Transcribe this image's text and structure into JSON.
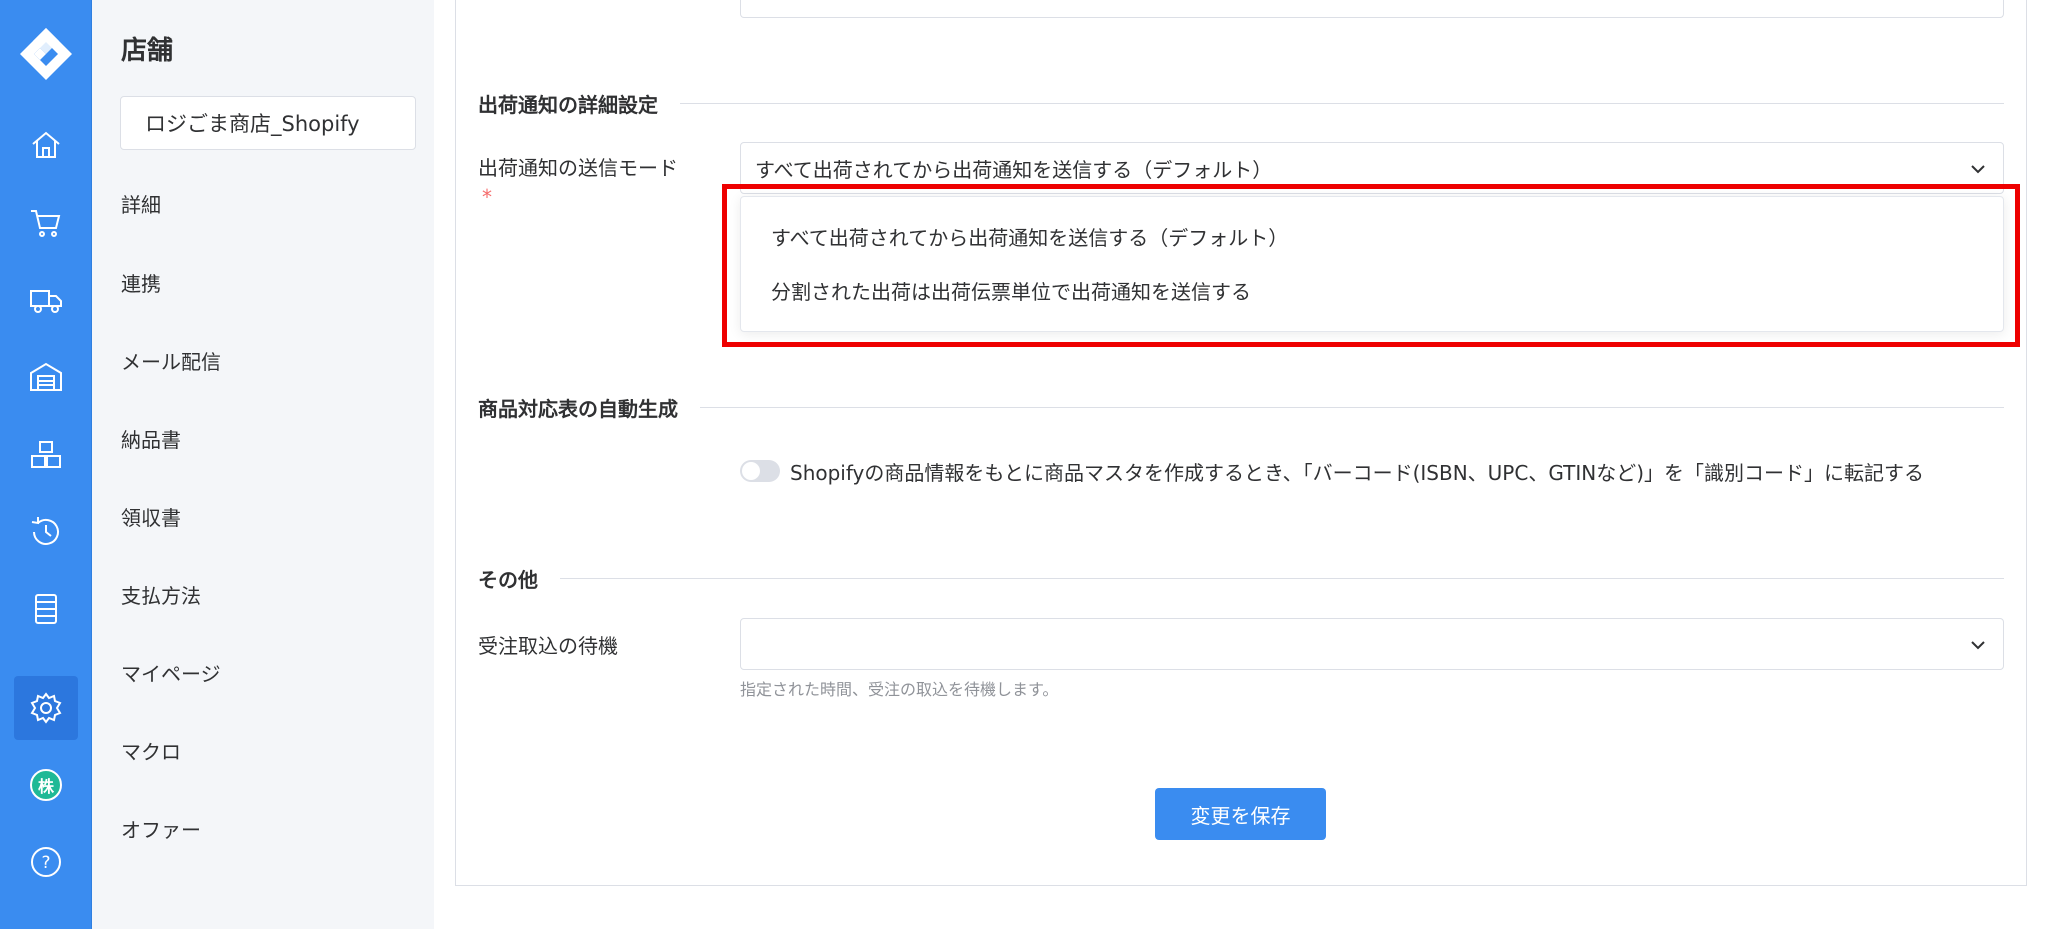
{
  "sidebar": {
    "title": "店舗",
    "store_name": "ロジごま商店_Shopify",
    "items": [
      "詳細",
      "連携",
      "メール配信",
      "納品書",
      "領収書",
      "支払方法",
      "マイページ",
      "マクロ",
      "オファー"
    ]
  },
  "rail": {
    "icons": [
      "home-icon",
      "cart-icon",
      "truck-icon",
      "warehouse-icon",
      "boxes-icon",
      "history-icon",
      "database-icon",
      "gear-icon",
      "company-badge-icon",
      "help-icon"
    ],
    "badge_text": "株",
    "help_text": "?",
    "accent": "#3a8cf0"
  },
  "shipping_notice": {
    "section_title": "出荷通知の詳細設定",
    "mode_label": "出荷通知の送信モード",
    "required_mark": "*",
    "selected": "すべて出荷されてから出荷通知を送信する（デフォルト）",
    "options": [
      "すべて出荷されてから出荷通知を送信する（デフォルト）",
      "分割された出荷は出荷伝票単位で出荷通知を送信する"
    ]
  },
  "product_map": {
    "section_title": "商品対応表の自動生成",
    "toggle_label": "Shopifyの商品情報をもとに商品マスタを作成するとき、「バーコード(ISBN、UPC、GTINなど)」を「識別コード」に転記する",
    "toggle_on": false
  },
  "other": {
    "section_title": "その他",
    "wait_label": "受注取込の待機",
    "wait_value": "",
    "wait_hint": "指定された時間、受注の取込を待機します。"
  },
  "save_label": "変更を保存",
  "highlight_color": "#ee0000"
}
